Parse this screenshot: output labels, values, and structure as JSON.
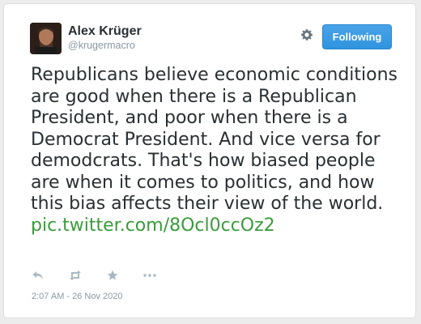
{
  "author": {
    "display_name": "Alex Krüger",
    "handle": "@krugermacro"
  },
  "header": {
    "settings_icon": "gear-icon",
    "follow_label": "Following"
  },
  "tweet": {
    "text": "Republicans believe economic conditions are good when there is a Republican President, and poor when there is a Democrat President. And vice versa for demodcrats. That's how biased people are when it comes to politics, and how this bias affects their view of the world.",
    "link": "pic.twitter.com/8Ocl0ccOz2",
    "timestamp": "2:07 AM - 26 Nov 2020"
  },
  "actions": [
    "reply-icon",
    "retweet-icon",
    "favorite-icon",
    "more-icon"
  ],
  "colors": {
    "follow_button": "#2f94e0",
    "link": "#3a9c3a",
    "text": "#292f33",
    "muted": "#8899a6"
  }
}
